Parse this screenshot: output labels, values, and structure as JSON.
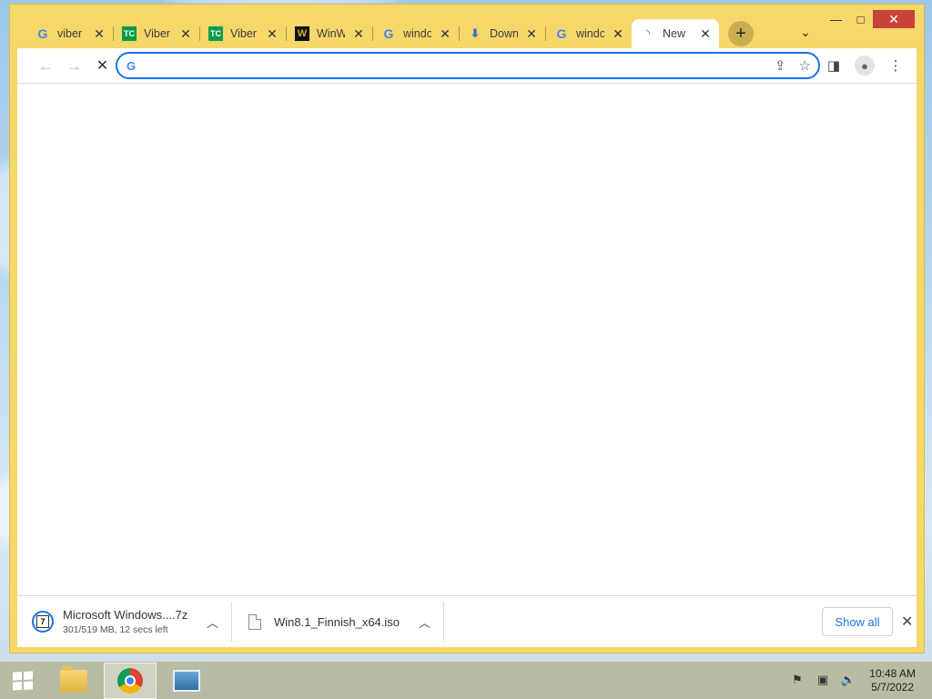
{
  "window": {
    "controls": {
      "minimize": "—",
      "maximize": "□",
      "close": "✕"
    }
  },
  "tabs": [
    {
      "title": "viber",
      "icon": "google-icon",
      "glyph": "G"
    },
    {
      "title": "Viber",
      "icon": "techcrunch-icon",
      "glyph": "TC"
    },
    {
      "title": "Viber",
      "icon": "techcrunch-icon",
      "glyph": "TC"
    },
    {
      "title": "WinW",
      "icon": "winworld-icon",
      "glyph": "W"
    },
    {
      "title": "windo",
      "icon": "google-icon",
      "glyph": "G"
    },
    {
      "title": "Down",
      "icon": "download-icon",
      "glyph": "⬇"
    },
    {
      "title": "windo",
      "icon": "google-icon",
      "glyph": "G"
    },
    {
      "title": "New",
      "icon": "loading-spinner-icon",
      "glyph": "◝",
      "active": true
    }
  ],
  "tab_close_glyph": "✕",
  "new_tab_glyph": "+",
  "tab_search_glyph": "⌄",
  "toolbar": {
    "back_glyph": "←",
    "forward_glyph": "→",
    "stop_glyph": "✕",
    "omnibox_icon": "G",
    "omnibox_value": "",
    "share_glyph": "⇪",
    "bookmark_glyph": "☆",
    "side_panel_glyph": "◨",
    "profile_glyph": "●",
    "menu_glyph": "⋮"
  },
  "downloads": [
    {
      "name": "Microsoft Windows....7z",
      "status": "301/519 MB, 12 secs left",
      "icon": "7zip-file-icon",
      "icon_glyph": "7"
    },
    {
      "name": "Win8.1_Finnish_x64.iso",
      "status": "",
      "icon": "file-icon"
    }
  ],
  "download_chevron": "︿",
  "shelf": {
    "show_all": "Show all",
    "close_glyph": "✕"
  },
  "taskbar": {
    "apps": [
      "file-explorer",
      "chrome",
      "photos"
    ],
    "tray_glyphs": [
      "⚑",
      "▣",
      "🔈"
    ],
    "time": "10:48 AM",
    "date": "5/7/2022"
  }
}
